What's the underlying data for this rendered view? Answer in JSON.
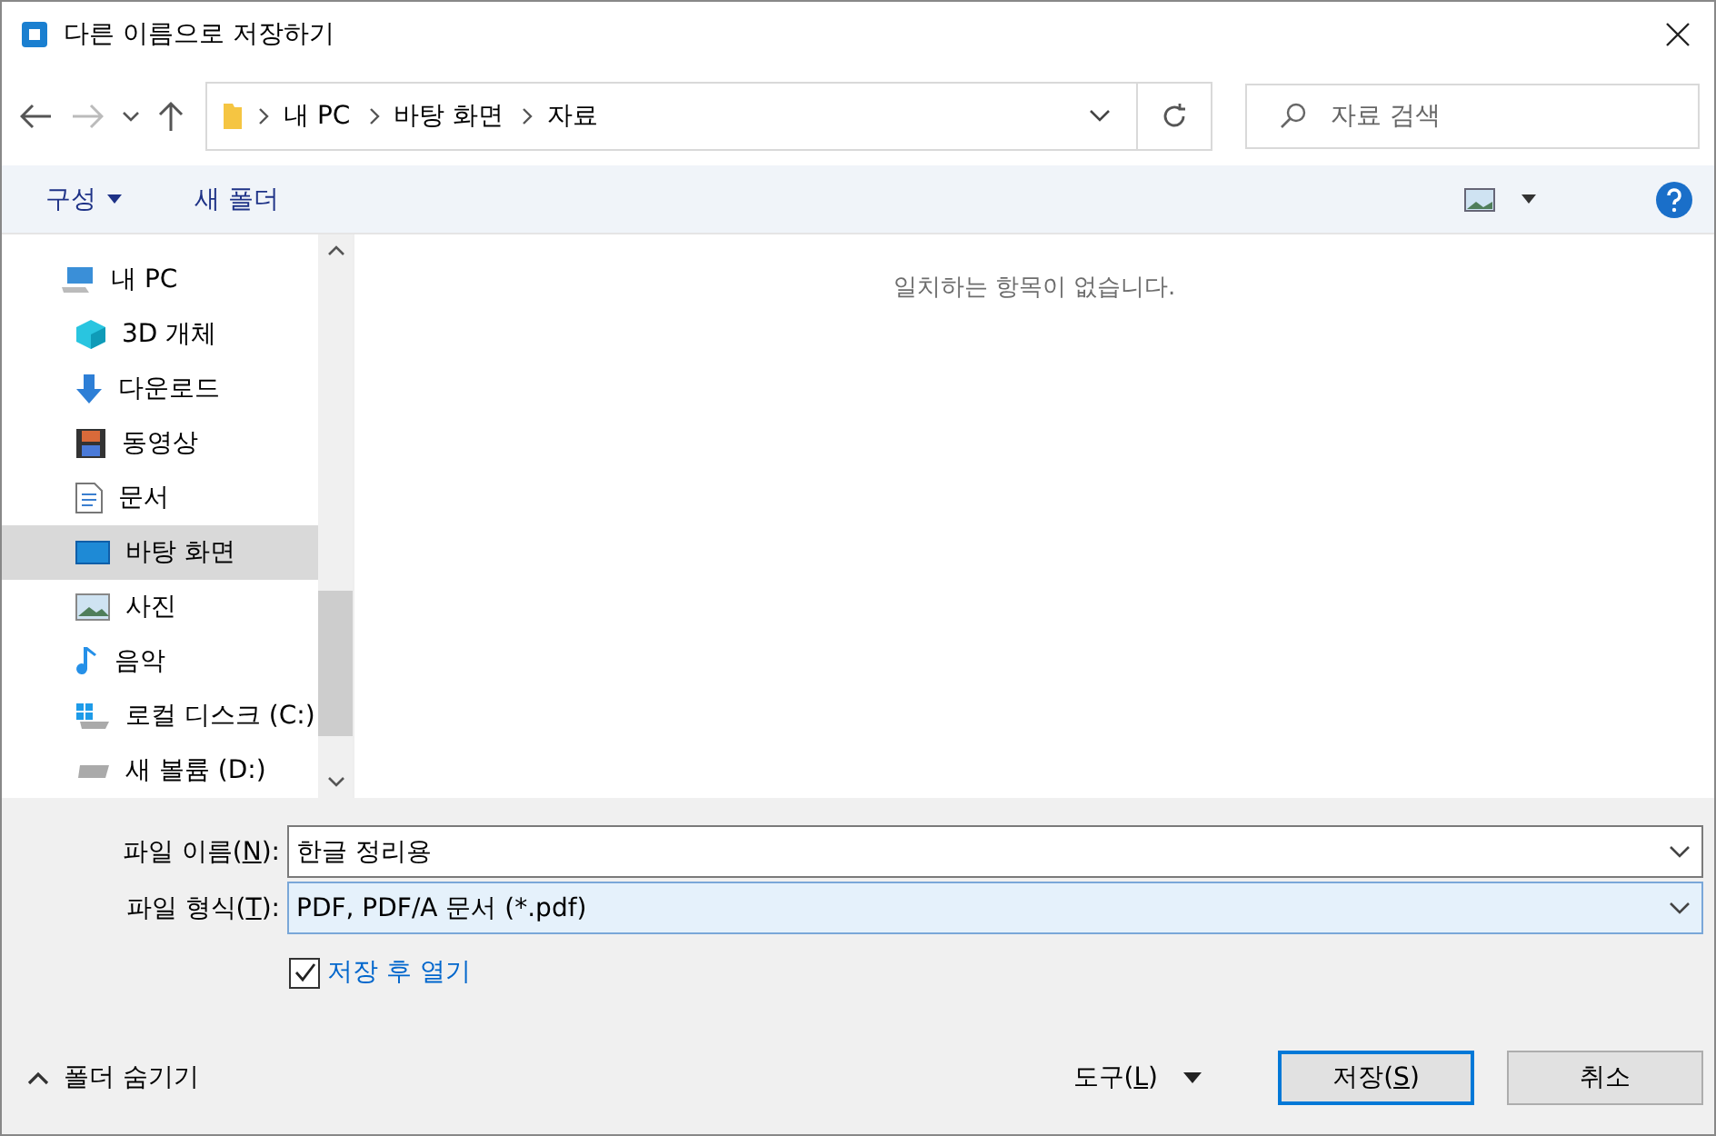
{
  "window": {
    "title": "다른 이름으로 저장하기"
  },
  "address": {
    "crumbs": [
      "내 PC",
      "바탕 화면",
      "자료"
    ]
  },
  "search": {
    "placeholder": "자료 검색"
  },
  "toolbar": {
    "organize": "구성",
    "new_folder": "새 폴더"
  },
  "sidebar": {
    "items": [
      {
        "label": "내 PC",
        "kind": "pc",
        "selected": false
      },
      {
        "label": "3D 개체",
        "kind": "cube",
        "selected": false
      },
      {
        "label": "다운로드",
        "kind": "download",
        "selected": false
      },
      {
        "label": "동영상",
        "kind": "video",
        "selected": false
      },
      {
        "label": "문서",
        "kind": "doc",
        "selected": false
      },
      {
        "label": "바탕 화면",
        "kind": "desktop",
        "selected": true
      },
      {
        "label": "사진",
        "kind": "photo",
        "selected": false
      },
      {
        "label": "음악",
        "kind": "music",
        "selected": false
      },
      {
        "label": "로컬 디스크 (C:)",
        "kind": "disk_c",
        "selected": false
      },
      {
        "label": "새 볼륨 (D:)",
        "kind": "disk",
        "selected": false
      }
    ]
  },
  "content": {
    "empty_message": "일치하는 항목이 없습니다."
  },
  "fields": [
    {
      "label": "파일 이름(",
      "access_key": "N",
      "label_end": "):",
      "value": "한글 정리용",
      "highlighted": false
    },
    {
      "label": "파일 형식(",
      "access_key": "T",
      "label_end": "):",
      "value": "PDF, PDF/A 문서 (*.pdf)",
      "highlighted": true
    }
  ],
  "open_after_save": {
    "label": "저장 후 열기",
    "checked": true
  },
  "hide_folders": "폴더 숨기기",
  "tools": {
    "label": "도구(",
    "access_key": "L",
    "label_end": ")"
  },
  "buttons": [
    {
      "label": "저장(",
      "access_key": "S",
      "label_end": ")",
      "kind": "primary"
    },
    {
      "label": "취소",
      "kind": "normal"
    }
  ]
}
